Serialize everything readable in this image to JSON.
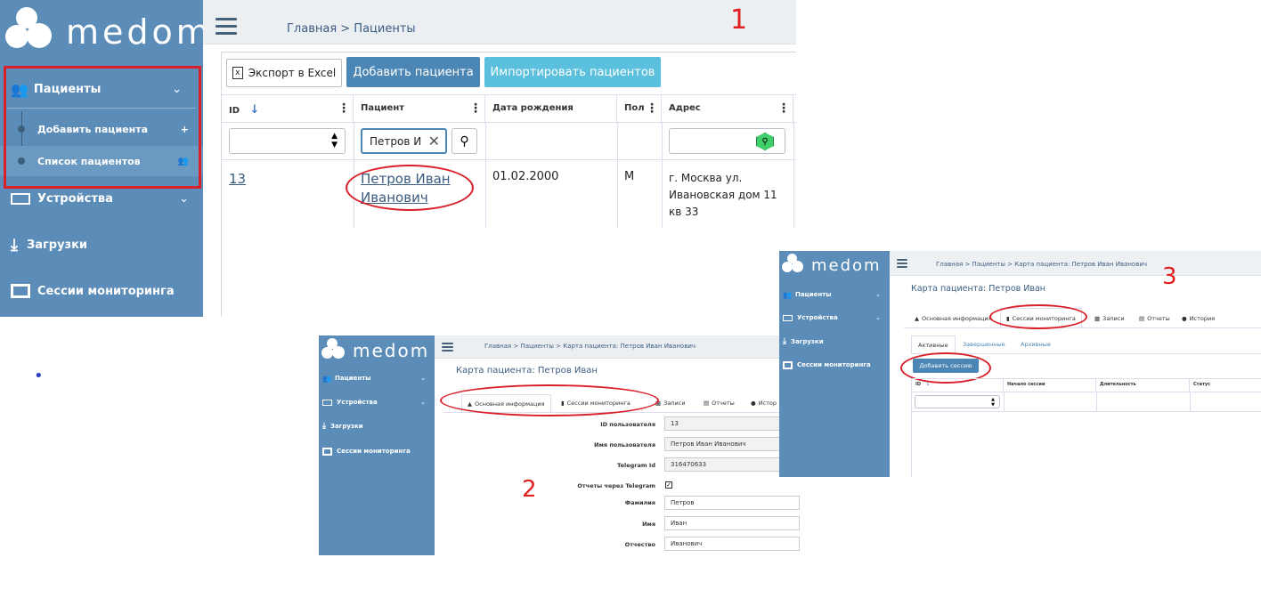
{
  "shot1": {
    "logo_text": "medom",
    "breadcrumb": "Главная > Пациенты",
    "step_number": "1",
    "nav": {
      "patients": "Пациенты",
      "add_patient": "Добавить пациента",
      "patient_list": "Список пациентов",
      "devices": "Устройства",
      "downloads": "Загрузки",
      "sessions": "Сессии мониторинга"
    },
    "toolbar": {
      "export_label": "Экспорт в Excel",
      "add_patient_label": "Добавить пациента",
      "import_label": "Импортировать пациентов"
    },
    "table": {
      "headers": {
        "id": "ID",
        "patient": "Пациент",
        "birth": "Дата рождения",
        "sex": "Пол",
        "address": "Адрес"
      },
      "filter_patient": "Петров И",
      "row": {
        "id": "13",
        "name_line1": "Петров Иван",
        "name_line2": "Иванович",
        "birth": "01.02.2000",
        "sex": "М",
        "addr_line1": "г. Москва ул.",
        "addr_line2": "Ивановская дом 11",
        "addr_line3": "кв 33"
      }
    },
    "colors": {
      "sidebar": "#5b8db8",
      "primary": "#4b86b4",
      "info": "#5bc0de",
      "annotation": "#d9202a"
    }
  },
  "shot2": {
    "logo_text": "medom",
    "breadcrumb": "Главная > Пациенты > Карта пациента: Петров Иван Иванович",
    "step_number": "2",
    "page_title": "Карта пациента: Петров Иван",
    "nav": {
      "patients": "Пациенты",
      "devices": "Устройства",
      "downloads": "Загрузки",
      "sessions": "Сессии мониторинга"
    },
    "tabs": {
      "info": "Основная информация",
      "sessions": "Сессии мониторинга",
      "records": "Записи",
      "reports": "Отчеты",
      "history": "Истор"
    },
    "fields": [
      {
        "label": "ID пользователя",
        "value": "13"
      },
      {
        "label": "Имя пользователя",
        "value": "Петров Иван Иванович"
      },
      {
        "label": "Telegram Id",
        "value": "316470633"
      },
      {
        "label": "Отчеты через Telegram",
        "value": ""
      },
      {
        "label": "Фамилия",
        "value": "Петров"
      },
      {
        "label": "Имя",
        "value": "Иван"
      },
      {
        "label": "Отчество",
        "value": "Иванович"
      }
    ]
  },
  "shot3": {
    "logo_text": "medom",
    "breadcrumb": "Главная > Пациенты > Карта пациента: Петров Иван Иванович",
    "step_number": "3",
    "page_title": "Карта пациента: Петров Иван",
    "nav": {
      "patients": "Пациенты",
      "devices": "Устройства",
      "downloads": "Загрузки",
      "sessions": "Сессии мониторинга"
    },
    "tabs": {
      "info": "Основная информация",
      "sessions": "Сессии мониторинга",
      "records": "Записи",
      "reports": "Отчеты",
      "history": "История"
    },
    "subtabs": {
      "active": "Активные",
      "completed": "Завершенные",
      "archived": "Архивные"
    },
    "add_session_label": "Добавить сессию",
    "table_headers": {
      "id": "ID",
      "start": "Начало сессии",
      "duration": "Длительность",
      "status": "Статус"
    }
  },
  "bullet": "•"
}
